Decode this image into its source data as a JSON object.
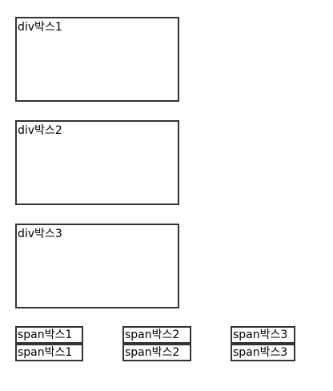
{
  "div_boxes": [
    {
      "label": "div박스1"
    },
    {
      "label": "div박스2"
    },
    {
      "label": "div박스3"
    }
  ],
  "span_boxes": {
    "row1": [
      {
        "label": "span박스1"
      },
      {
        "label": "span박스2"
      },
      {
        "label": "span박스3"
      }
    ],
    "row2": [
      {
        "label": "span박스1"
      },
      {
        "label": "span박스2"
      },
      {
        "label": "span박스3"
      }
    ]
  },
  "colors": {
    "border": "#333333",
    "background": "#ffffff",
    "text": "#000000"
  }
}
